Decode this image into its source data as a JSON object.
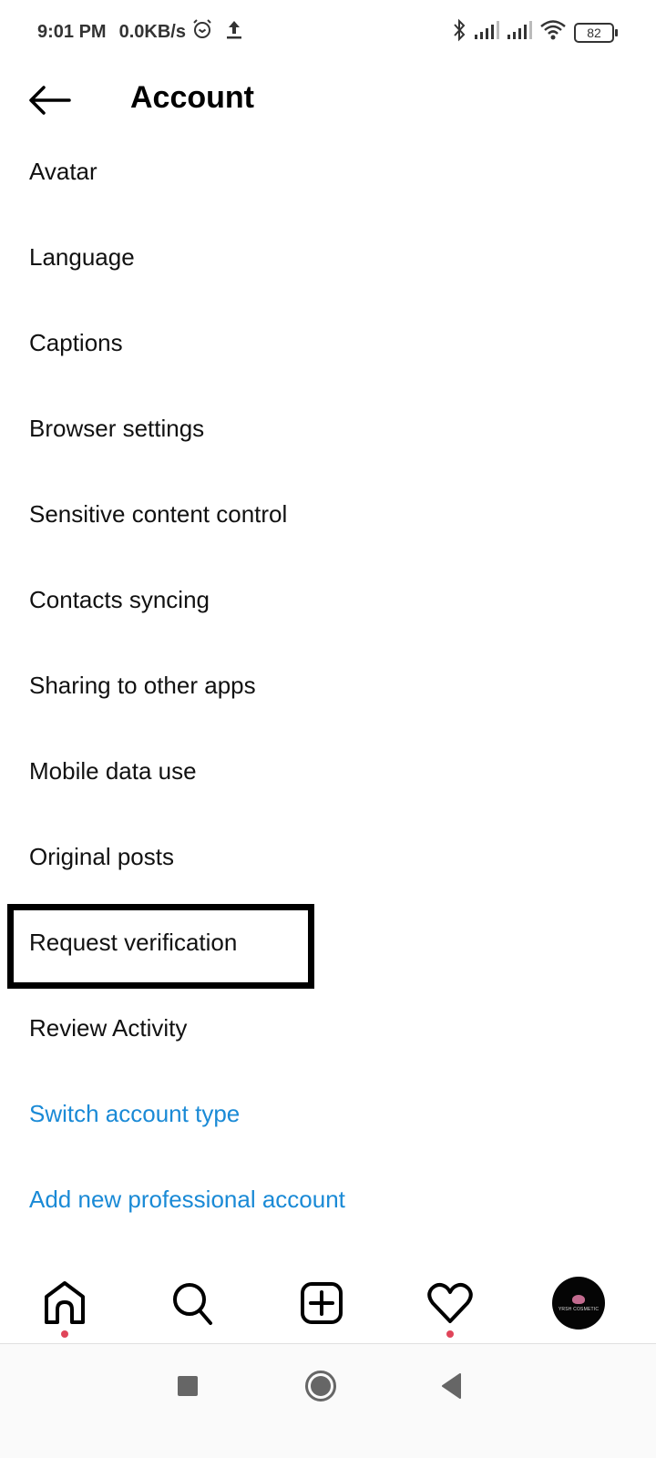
{
  "status_bar": {
    "time": "9:01 PM",
    "network_speed": "0.0KB/s",
    "battery_level": "82",
    "icons": [
      "alarm-icon",
      "upload-icon",
      "bluetooth-icon",
      "signal-icon",
      "signal-icon",
      "wifi-icon",
      "battery-icon"
    ]
  },
  "header": {
    "title": "Account",
    "back_icon": "arrow-left-icon"
  },
  "menu": {
    "items": [
      {
        "label": "Avatar",
        "style": "default"
      },
      {
        "label": "Language",
        "style": "default"
      },
      {
        "label": "Captions",
        "style": "default"
      },
      {
        "label": "Browser settings",
        "style": "default"
      },
      {
        "label": "Sensitive content control",
        "style": "default"
      },
      {
        "label": "Contacts syncing",
        "style": "default"
      },
      {
        "label": "Sharing to other apps",
        "style": "default"
      },
      {
        "label": "Mobile data use",
        "style": "default"
      },
      {
        "label": "Original posts",
        "style": "default"
      },
      {
        "label": "Request verification",
        "style": "default",
        "highlighted": true
      },
      {
        "label": "Review Activity",
        "style": "default"
      },
      {
        "label": "Switch account type",
        "style": "link"
      },
      {
        "label": "Add new professional account",
        "style": "link"
      }
    ],
    "link_color": "#1a8ad6"
  },
  "tab_bar": {
    "tabs": [
      {
        "name": "home",
        "icon": "home-icon",
        "notification_dot": true
      },
      {
        "name": "search",
        "icon": "search-icon",
        "notification_dot": false
      },
      {
        "name": "create",
        "icon": "plus-square-icon",
        "notification_dot": false
      },
      {
        "name": "activity",
        "icon": "heart-icon",
        "notification_dot": true
      },
      {
        "name": "profile",
        "icon": "avatar",
        "notification_dot": false
      }
    ],
    "profile_brand_text": "YRSH COSMETIC",
    "notification_color": "#e0455a"
  },
  "system_nav": {
    "buttons": [
      "recents-icon",
      "home-circle-icon",
      "back-triangle-icon"
    ]
  }
}
